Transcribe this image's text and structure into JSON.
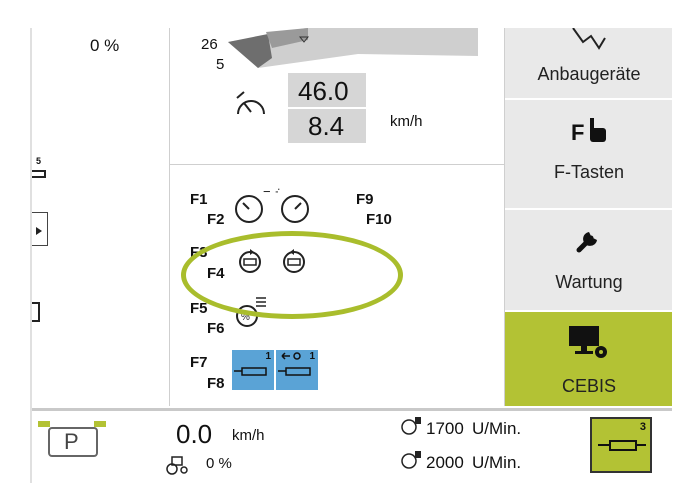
{
  "left_panel": {
    "percent_value": "0 %",
    "hitch_number": "5"
  },
  "speed_panel": {
    "gear_top": "26",
    "gear_bottom": "5",
    "speed_target": "46.0",
    "speed_actual": "8.4",
    "speed_unit": "km/h"
  },
  "function_keys": {
    "f1": "F1",
    "f2": "F2",
    "f3": "F3",
    "f4": "F4",
    "f5": "F5",
    "f6": "F6",
    "f7": "F7",
    "f8": "F8",
    "f9": "F9",
    "f10": "F10",
    "cruise_minus": "−",
    "cruise_plus": "+",
    "hydraulic_left_num": "1",
    "hydraulic_right_num": "1"
  },
  "sidebar": {
    "items": [
      {
        "label": "Anbaugeräte",
        "icon": "implements-icon"
      },
      {
        "label": "F-Tasten",
        "icon": "f-hand-icon",
        "icon_text": "F"
      },
      {
        "label": "Wartung",
        "icon": "wrench-icon"
      },
      {
        "label": "CEBIS",
        "icon": "monitor-gear-icon",
        "active": true
      }
    ],
    "accent_color": "#b3c234"
  },
  "status_bar": {
    "parking": "P",
    "speed_value": "0.0",
    "speed_unit": "km/h",
    "slip_value": "0 %",
    "rpm1_value": "1700",
    "rpm1_unit": "U/Min.",
    "rpm2_value": "2000",
    "rpm2_unit": "U/Min.",
    "hydraulic_num": "3"
  },
  "colors": {
    "highlight_ellipse": "#a9bd2c",
    "hydraulic_blue": "#5aa3d6"
  }
}
